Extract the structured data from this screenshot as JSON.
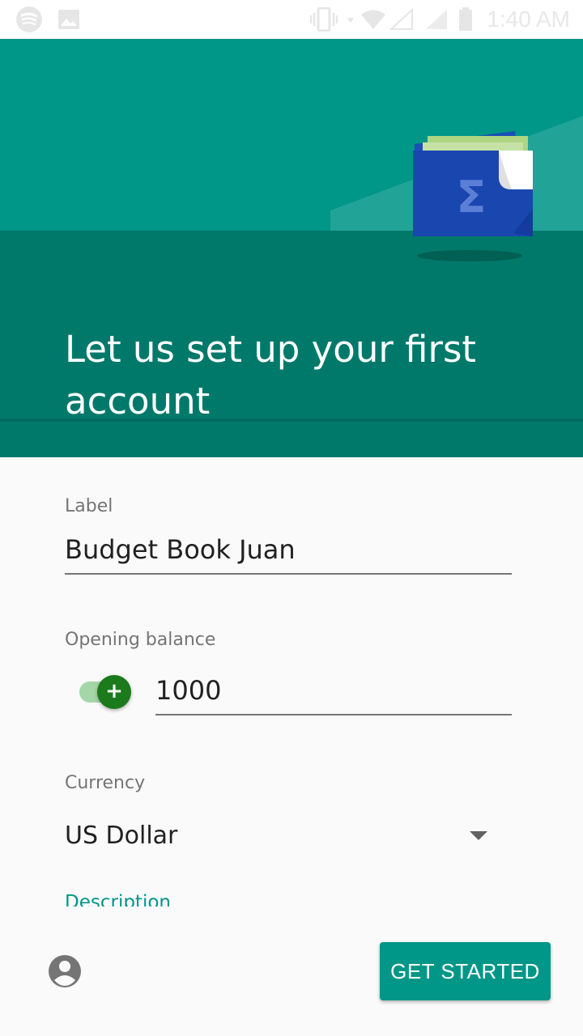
{
  "status_bar": {
    "time": "1:40 AM",
    "left_icons": [
      "spotify-icon",
      "image-icon"
    ],
    "right_icons": [
      "vibrate-icon",
      "wifi-icon",
      "signal-icon",
      "battery-icon"
    ]
  },
  "header": {
    "title": "Let us set up your first account",
    "illustration": "wallet-sigma-icon",
    "colors": {
      "top": "#009688",
      "bottom": "#00796b"
    }
  },
  "form": {
    "label_field": {
      "label": "Label",
      "value": "Budget Book Juan"
    },
    "balance_field": {
      "label": "Opening balance",
      "value": "1000",
      "sign_toggle": "+",
      "sign_positive": true
    },
    "currency_field": {
      "label": "Currency",
      "value": "US Dollar"
    },
    "description_field": {
      "label": "Description"
    }
  },
  "footer": {
    "account_icon": "account-circle-icon",
    "get_started_label": "GET STARTED",
    "accent_color": "#009688"
  }
}
